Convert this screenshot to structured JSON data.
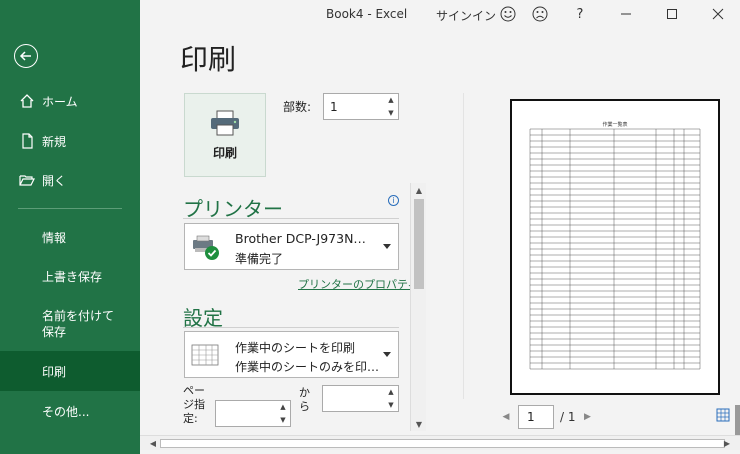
{
  "window": {
    "title": "Book4  -  Excel",
    "signin": "サインイン",
    "help": "?"
  },
  "sidebar": {
    "items": [
      {
        "label": "ホーム",
        "icon": "home-icon"
      },
      {
        "label": "新規",
        "icon": "new-file-icon"
      },
      {
        "label": "開く",
        "icon": "folder-open-icon"
      },
      {
        "label": "情報"
      },
      {
        "label": "上書き保存"
      },
      {
        "label": "名前を付けて保存"
      },
      {
        "label": "印刷",
        "active": true
      },
      {
        "label": "その他..."
      }
    ]
  },
  "page_title": "印刷",
  "print_button": {
    "label": "印刷"
  },
  "copies": {
    "label": "部数:",
    "value": "1"
  },
  "printer": {
    "heading": "プリンター",
    "name": "Brother DCP-J973N…",
    "status": "準備完了",
    "properties_link": "プリンターのプロパティ"
  },
  "settings": {
    "heading": "設定",
    "scope_line1": "作業中のシートを印刷",
    "scope_line2": "作業中のシートのみを印…",
    "pages_label": "ページ指定:",
    "to_label": "から",
    "from_value": "",
    "to_value": ""
  },
  "preview": {
    "sheet_title": "作業一覧表",
    "current_page": "1",
    "total_pages": "/ 1"
  },
  "colors": {
    "accent": "#217346",
    "sidebar_active": "#0e5c2f"
  }
}
